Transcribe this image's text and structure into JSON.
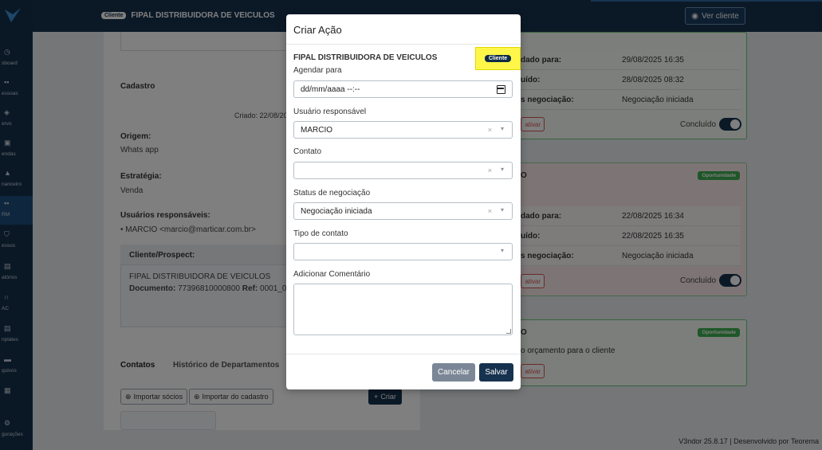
{
  "sidebar": {
    "items": [
      {
        "label": "sboard",
        "icon": "dashboard-icon"
      },
      {
        "label": "essoas",
        "icon": "people-icon"
      },
      {
        "label": "ervo",
        "icon": "box-icon"
      },
      {
        "label": "endas",
        "icon": "cart-icon"
      },
      {
        "label": "nanceiro",
        "icon": "bank-icon"
      },
      {
        "label": "RM",
        "icon": "crm-icon"
      },
      {
        "label": "essos",
        "icon": "shield-icon"
      },
      {
        "label": "atórios",
        "icon": "report-icon"
      },
      {
        "label": "AC",
        "icon": "headset-icon"
      },
      {
        "label": "nplates",
        "icon": "template-icon"
      },
      {
        "label": "quivos",
        "icon": "folder-icon"
      },
      {
        "label": "",
        "icon": "bank-icon"
      },
      {
        "label": "gurações",
        "icon": "gear-icon"
      }
    ]
  },
  "header": {
    "badge": "Cliente",
    "title": "FIPAL DISTRIBUIDORA DE VEICULOS",
    "ver_cliente": "Ver cliente"
  },
  "background": {
    "cadastro": "Cadastro",
    "criado": "Criado: 22/08/20",
    "origem_label": "Origem:",
    "origem_value": "Whats app",
    "estrategia_label": "Estratégia:",
    "estrategia_value": "Venda",
    "usuarios_label": "Usuários responsáveis:",
    "usuario_value": "MARCIO <marcio@marticar.com.br>",
    "cliente_prospect": "Cliente/Prospect:",
    "cliente_nome": "FIPAL DISTRIBUIDORA DE VEICULOS",
    "documento_label": "Documento:",
    "documento_value": "77396810000800",
    "ref_label": "Ref:",
    "ref_value": "0001_00",
    "tab_contatos": "Contatos",
    "tab_historico": "Histórico de Departamentos",
    "btn_importar_socios": "Importar sócios",
    "btn_importar_cadastro": "Importar do cadastro",
    "btn_criar": "Criar",
    "cards": [
      {
        "rows": [
          {
            "k": "dado para:",
            "v": "29/08/2025 16:35"
          },
          {
            "k": "uído:",
            "v": "28/08/2025 08:32"
          },
          {
            "k": "s negociação:",
            "v": "Negociação iniciada"
          }
        ],
        "ativar": "ativar",
        "concluido": "Concluído"
      },
      {
        "title": "O",
        "badge": "Oportunidade",
        "rows": [
          {
            "k": "dado para:",
            "v": "22/08/2025 16:34"
          },
          {
            "k": "uído:",
            "v": "22/08/2025 16:35"
          },
          {
            "k": "s negociação:",
            "v": "Negociação iniciada"
          }
        ],
        "ativar": "ativar",
        "concluido": "Concluído"
      },
      {
        "title": "O",
        "badge": "Oportunidade",
        "desc": "o orçamento para o cliente",
        "ativar": "ativar"
      }
    ]
  },
  "footer": {
    "text": "V3ndor 25.8.17 | Desenvolvido por Teorema"
  },
  "modal": {
    "title": "Criar Ação",
    "company": "FIPAL DISTRIBUIDORA DE VEICULOS",
    "badge": "Cliente",
    "agendar_label": "Agendar para",
    "agendar_value": "dd/mm/aaaa --:--",
    "usuario_label": "Usuário responsável",
    "usuario_value": "MARCIO",
    "contato_label": "Contato",
    "contato_value": "",
    "status_label": "Status de negociação",
    "status_value": "Negociação iniciada",
    "tipo_label": "Tipo de contato",
    "tipo_value": "",
    "comentario_label": "Adicionar Comentário",
    "cancel": "Cancelar",
    "save": "Salvar"
  },
  "colors": {
    "primary": "#16324f",
    "success": "#3fae51",
    "highlight": "#fff64a"
  }
}
